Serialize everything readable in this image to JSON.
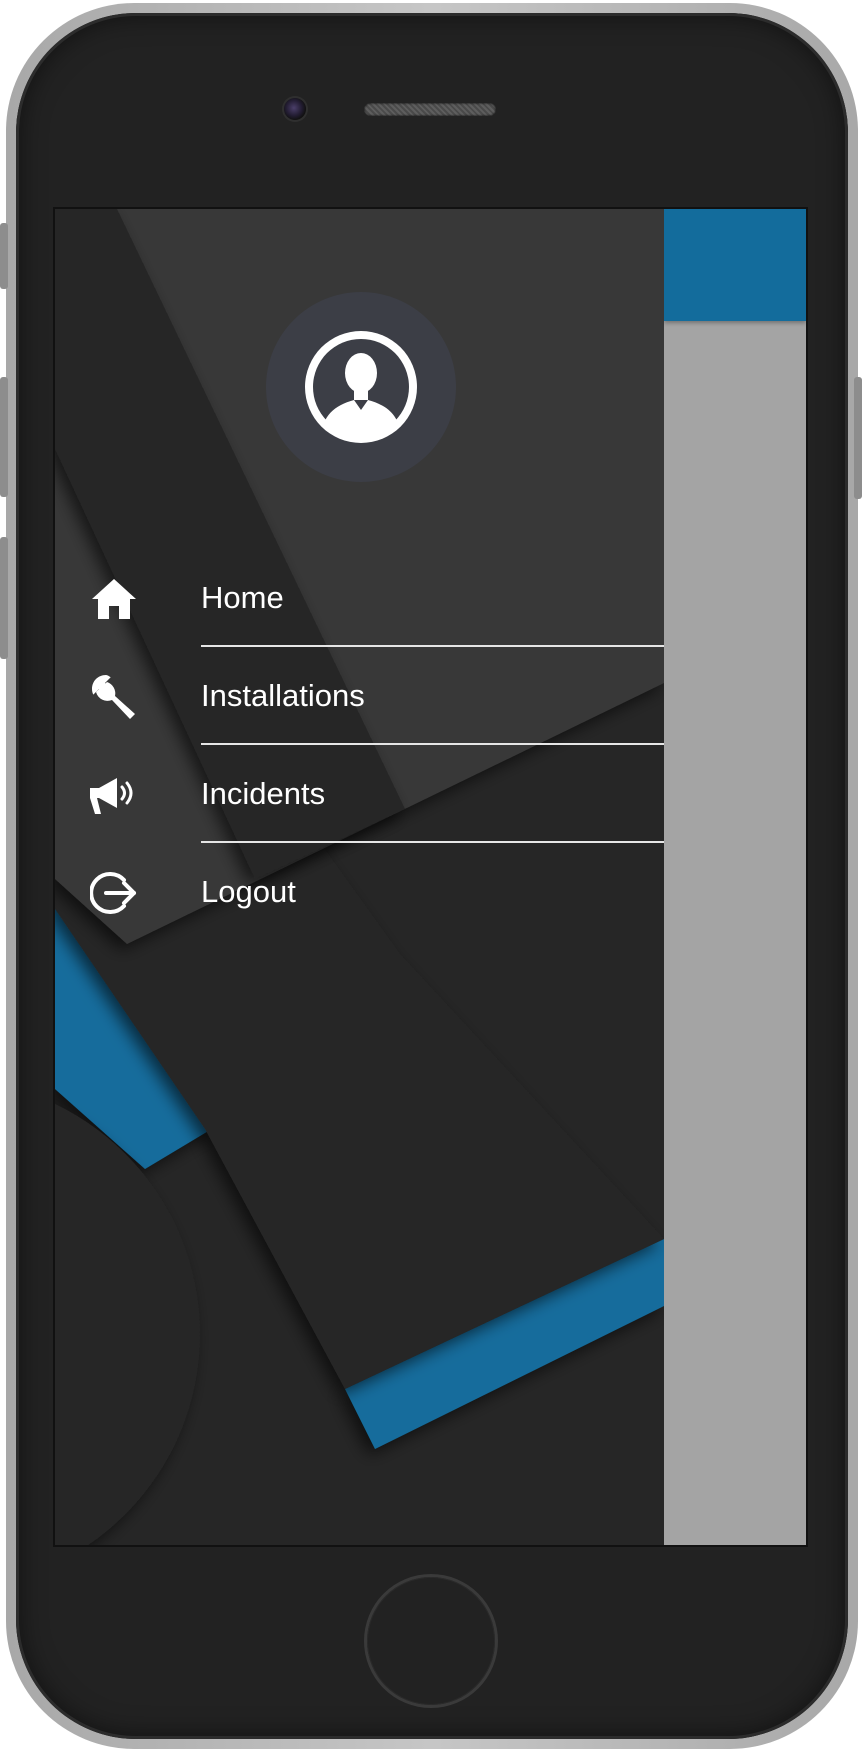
{
  "device": {
    "type": "smartphone"
  },
  "colors": {
    "accent": "#136c9c",
    "drawer_background": "#262626",
    "drawer_band": "#383838",
    "scrim": "#a4a4a4",
    "avatar_circle": "#3c3e46",
    "text": "#ffffff"
  },
  "header": {
    "avatar_icon": "user-account-circle-icon"
  },
  "menu": {
    "items": [
      {
        "label": "Home",
        "icon": "home-icon"
      },
      {
        "label": "Installations",
        "icon": "wrench-icon"
      },
      {
        "label": "Incidents",
        "icon": "megaphone-icon"
      },
      {
        "label": "Logout",
        "icon": "logout-icon"
      }
    ]
  }
}
